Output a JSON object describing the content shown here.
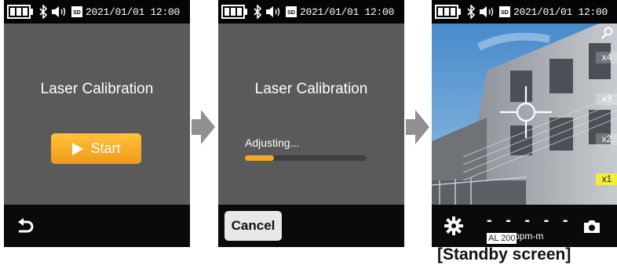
{
  "status_bar": {
    "time": "2021/01/01 12:00"
  },
  "screen1": {
    "title": "Laser Calibration",
    "start_label": "Start"
  },
  "screen2": {
    "title": "Laser Calibration",
    "adjusting_label": "Adjusting...",
    "progress": 0.24,
    "cancel_label": "Cancel"
  },
  "screen3": {
    "zoom_levels": [
      "x4",
      "x3",
      "x2",
      "x1"
    ],
    "active_zoom": "x1",
    "reading": "- - - - -",
    "alarm_label": "AL 200",
    "unit": "ppm-m",
    "caption": "[Standby screen]"
  },
  "colors": {
    "accent": "#f5a825",
    "active_zoom": "#f4ec3a",
    "status_bg": "#050505"
  },
  "icons": [
    "battery-icon",
    "bluetooth-icon",
    "speaker-icon",
    "sd-card-icon",
    "play-icon",
    "back-icon",
    "search-icon",
    "gear-icon",
    "camera-icon",
    "crosshair-icon",
    "next-step-arrow-icon"
  ]
}
